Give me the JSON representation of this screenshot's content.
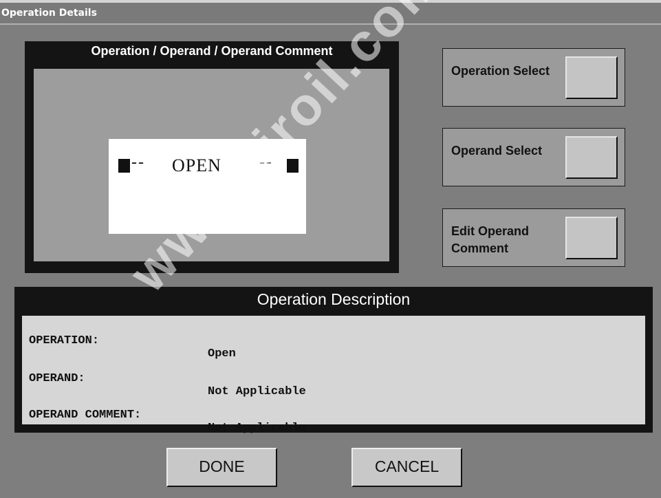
{
  "window": {
    "title": "Operation Details"
  },
  "operation_panel": {
    "header": "Operation / Operand / Operand Comment",
    "ladder": {
      "dash_left": "-- ",
      "text": "OPEN",
      "dash_right": "--"
    }
  },
  "side_buttons": {
    "operation_select": {
      "label": "Operation Select"
    },
    "operand_select": {
      "label": "Operand Select"
    },
    "edit_operand_comment": {
      "label": "Edit Operand Comment"
    }
  },
  "description": {
    "header": "Operation Description",
    "rows": [
      {
        "key": "OPERATION:",
        "value": "Open"
      },
      {
        "key": "OPERAND:",
        "value": "Not Applicable"
      },
      {
        "key": "OPERAND COMMENT:",
        "value": "Not Applicable"
      }
    ]
  },
  "buttons": {
    "done": "DONE",
    "cancel": "CANCEL"
  },
  "watermark": "www.airoil.com"
}
